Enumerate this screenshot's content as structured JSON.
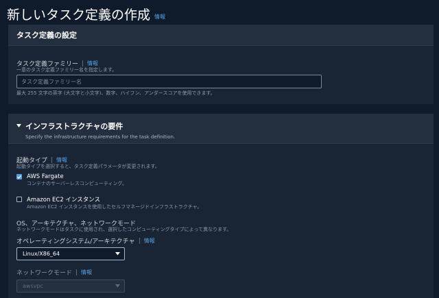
{
  "page": {
    "title": "新しいタスク定義の作成",
    "info_link": "情報"
  },
  "task_definition_config": {
    "section_title": "タスク定義の設定",
    "family": {
      "label": "タスク定義ファミリー",
      "info_link": "情報",
      "description": "一意のタスク定義ファミリー名を指定します。",
      "placeholder": "タスク定義ファミリー名",
      "value": "",
      "constraint": "最大 255 文字の英字 (大文字と小文字)、数字、ハイフン、アンダースコアを使用できます。"
    }
  },
  "infrastructure": {
    "section_title": "インフラストラクチャの要件",
    "section_subtitle": "Specify the infrastructure requirements for the task definition.",
    "expanded": true,
    "launch_type": {
      "label": "起動タイプ",
      "info_link": "情報",
      "description": "起動タイプを選択すると、タスク定義パラメータが変更されます。",
      "options": [
        {
          "label": "AWS Fargate",
          "description": "コンテナのサーバーレスコンピューティング。",
          "checked": true
        },
        {
          "label": "Amazon EC2 インスタンス",
          "description": "Amazon EC2 インスタンスを使用したセルフマネージドインフラストラクチャ。",
          "checked": false
        }
      ]
    },
    "os_arch_network": {
      "heading": "OS、アーキテクチャ、ネットワークモード",
      "description": "ネットワークモードはタスクに使用され、選択したコンピューティングタイプによって異なります。"
    },
    "os_arch": {
      "label": "オペレーティングシステム/アーキテクチャ",
      "info_link": "情報",
      "selected": "Linux/X86_64"
    },
    "network_mode": {
      "label": "ネットワークモード",
      "info_link": "情報",
      "selected": "awsvpc",
      "disabled": true
    }
  },
  "colors": {
    "page_bg": "#0f1b2a",
    "panel_bg": "#192534",
    "panel_header_bg": "#232f3e",
    "link": "#539fe5",
    "text": "#d1d5db",
    "muted": "#8d99a8"
  }
}
